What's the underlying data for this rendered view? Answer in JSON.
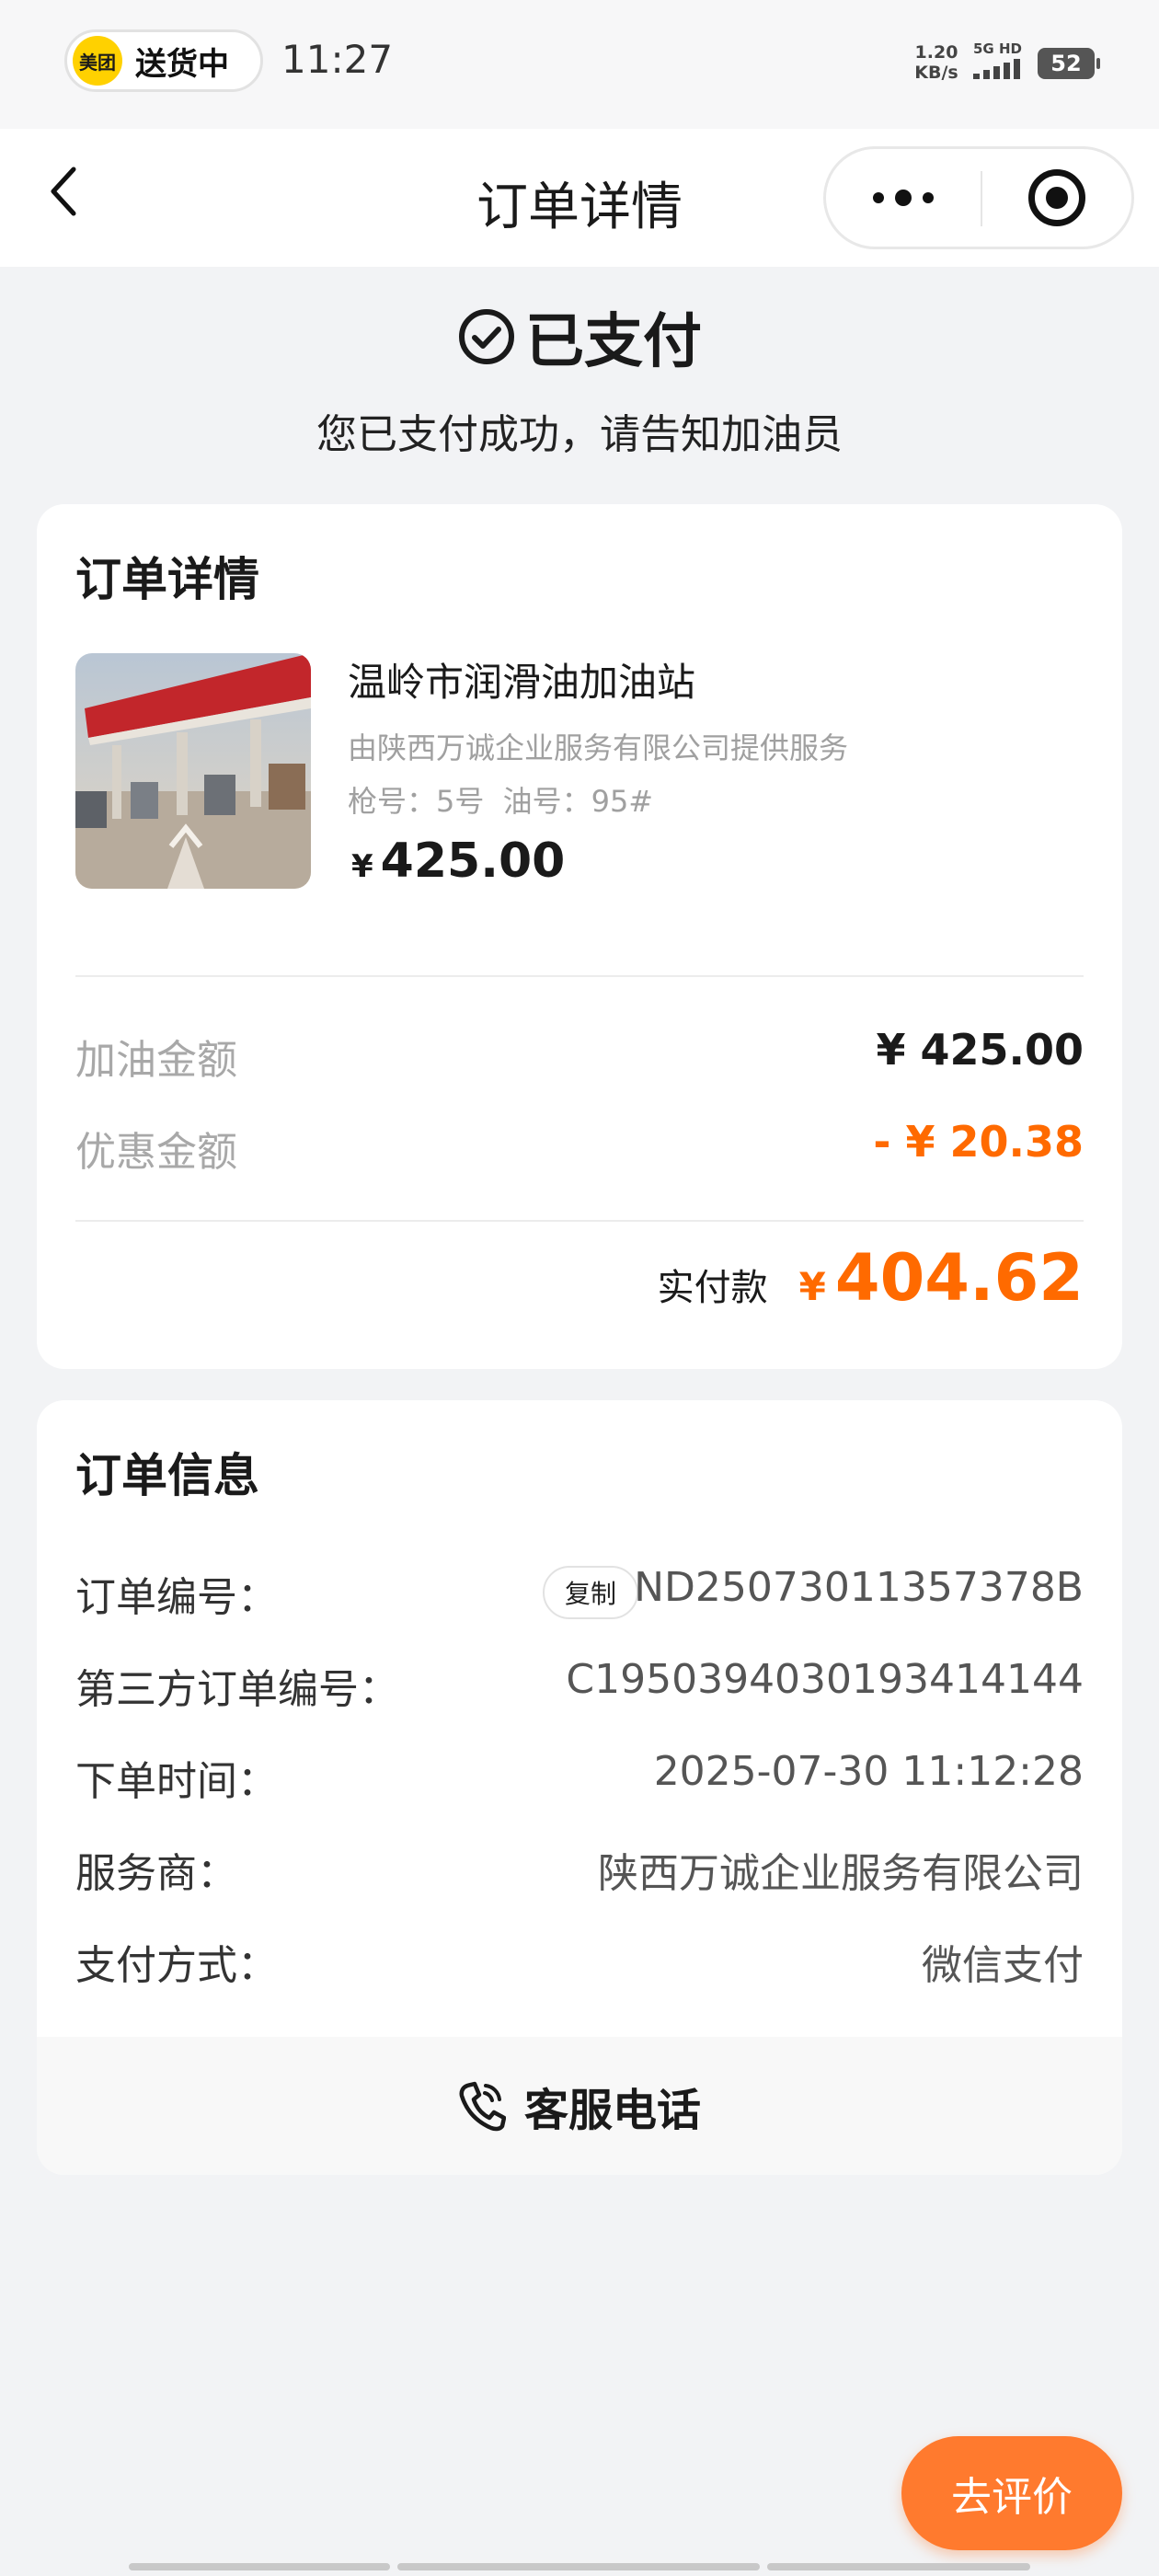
{
  "status_bar": {
    "delivery_logo_text": "美团",
    "delivery_status": "送货中",
    "time": "11:27",
    "network_speed_value": "1.20",
    "network_speed_unit": "KB/s",
    "network_type": "5G HD",
    "battery_level": "52"
  },
  "nav": {
    "title": "订单详情"
  },
  "payment": {
    "status_title": "已支付",
    "status_subtitle": "您已支付成功，请告知加油员"
  },
  "order_details": {
    "section_title": "订单详情",
    "station_name": "温岭市润滑油加油站",
    "provider": "由陕西万诚企业服务有限公司提供服务",
    "gun_label": "枪号：",
    "gun_value": "5号",
    "oil_label": "油号：",
    "oil_value": "95#",
    "price_currency": "¥",
    "price_value": "425.00",
    "fuel_amount_label": "加油金额",
    "fuel_amount_value": "¥ 425.00",
    "discount_label": "优惠金额",
    "discount_value": "- ¥ 20.38",
    "paid_label": "实付款",
    "paid_currency": "¥",
    "paid_amount": "404.62"
  },
  "order_info": {
    "section_title": "订单信息",
    "copy_label": "复制",
    "rows": [
      {
        "label": "订单编号：",
        "value": "ND25073011357378B"
      },
      {
        "label": "第三方订单编号：",
        "value": "C1950394030193414144"
      },
      {
        "label": "下单时间：",
        "value": "2025-07-30 11:12:28"
      },
      {
        "label": "服务商：",
        "value": "陕西万诚企业服务有限公司"
      },
      {
        "label": "支付方式：",
        "value": "微信支付"
      }
    ],
    "service_phone_label": "客服电话"
  },
  "review_button_label": "去评价",
  "colors": {
    "accent_orange": "#ff6a00",
    "review_button": "#ff7a2e",
    "page_background": "#f2f3f5"
  }
}
